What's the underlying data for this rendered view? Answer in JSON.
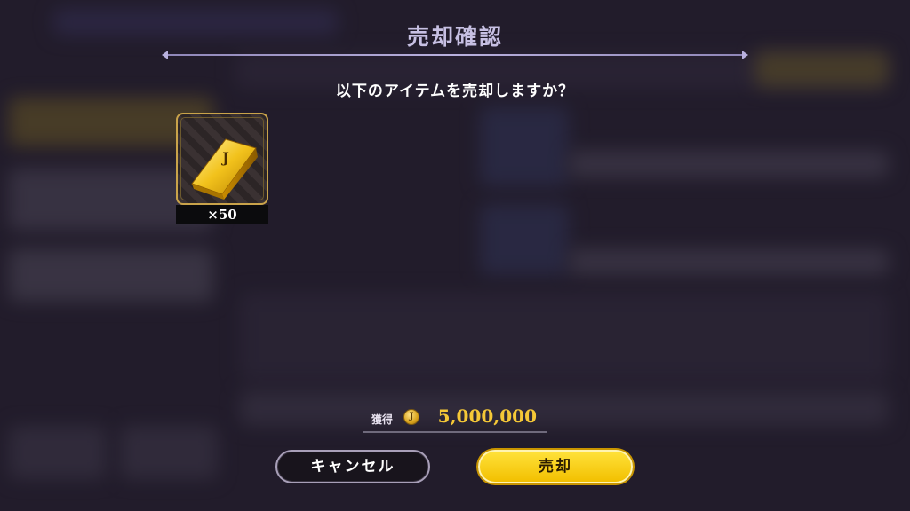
{
  "dialog": {
    "title": "売却確認",
    "question": "以下のアイテムを売却しますか？",
    "item": {
      "icon": "gold-bar-icon",
      "emblem": "J",
      "count_label": "×50"
    },
    "gain": {
      "label": "獲得",
      "coin_icon": "coin-icon",
      "coin_symbol": "J",
      "value": "5,000,000"
    },
    "buttons": {
      "cancel": "キャンセル",
      "sell": "売却"
    }
  },
  "colors": {
    "title": "#c7c0e3",
    "gain_value": "#f5c837",
    "sell_button": "#ffd400",
    "cancel_button": "#18141c"
  }
}
